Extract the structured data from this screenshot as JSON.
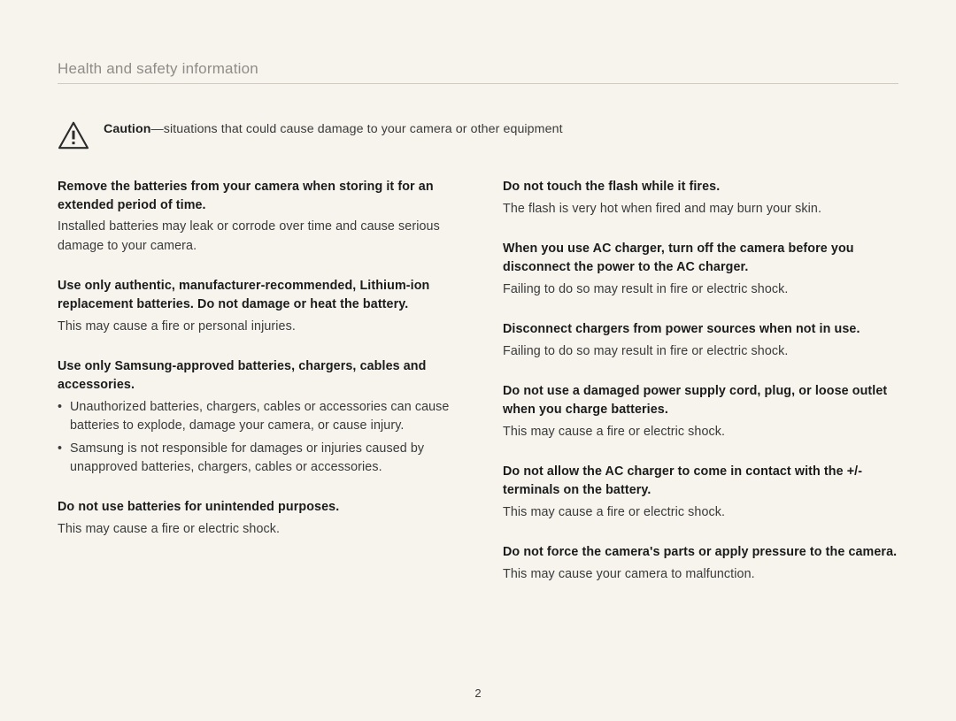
{
  "header": "Health and safety information",
  "caution": {
    "label": "Caution",
    "text": "—situations that could cause damage to your camera or other equipment"
  },
  "left": [
    {
      "heading": "Remove the batteries from your camera when storing it for an extended period of time.",
      "body": "Installed batteries may leak or corrode over time and cause serious damage to your camera."
    },
    {
      "heading": "Use only authentic, manufacturer-recommended, Lithium-ion replacement batteries. Do not damage or heat the battery.",
      "body": "This may cause a fire or personal injuries."
    },
    {
      "heading": "Use only Samsung-approved batteries, chargers, cables and accessories.",
      "bullets": [
        "Unauthorized batteries, chargers, cables or accessories can cause batteries to explode, damage your camera, or cause injury.",
        "Samsung is not responsible for damages or injuries caused by unapproved batteries, chargers, cables or accessories."
      ]
    },
    {
      "heading": "Do not use batteries for unintended purposes.",
      "body": "This may cause a fire or electric shock."
    }
  ],
  "right": [
    {
      "heading": "Do not touch the flash while it fires.",
      "body": "The flash is very hot when fired and may burn your skin."
    },
    {
      "heading": "When you use AC charger, turn off the camera before you disconnect the power to the AC charger.",
      "body": "Failing to do so may result in fire or electric shock."
    },
    {
      "heading": "Disconnect chargers from power sources when not in use.",
      "body": "Failing to do so may result in fire or electric shock."
    },
    {
      "heading": "Do not use a damaged power supply cord, plug, or loose outlet when you charge batteries.",
      "body": "This may cause a fire or electric shock."
    },
    {
      "heading": "Do not allow the AC charger to come in contact with the +/- terminals on the battery.",
      "body": "This may cause a fire or electric shock."
    },
    {
      "heading": "Do not force the camera's parts or apply pressure to the camera.",
      "body": "This may cause your camera to malfunction."
    }
  ],
  "page_number": "2"
}
